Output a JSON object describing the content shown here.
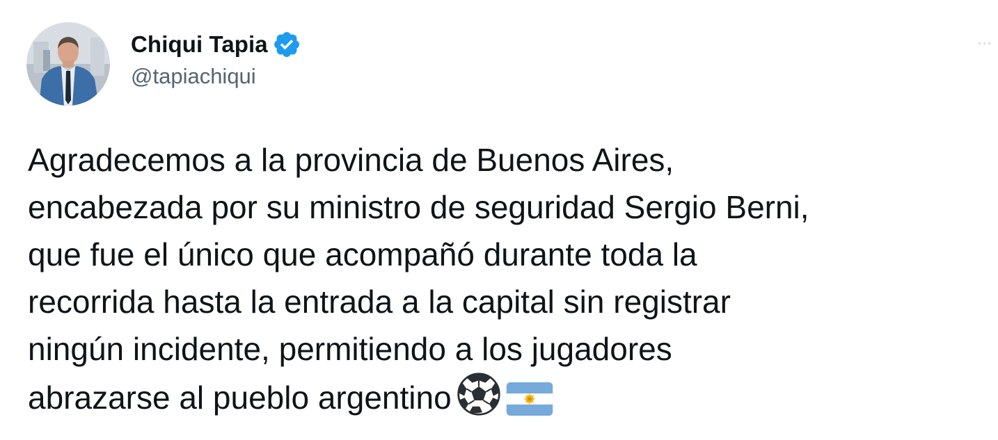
{
  "user": {
    "display_name": "Chiqui Tapia",
    "handle": "@tapiachiqui",
    "verified_icon": "verified-badge-icon"
  },
  "tweet": {
    "lines": [
      "Agradecemos a la provincia de Buenos Aires,",
      "encabezada por su ministro de seguridad Sergio Berni,",
      "que fue el único que acompañó durante toda la",
      "recorrida hasta la entrada a la capital sin registrar",
      "ningún incidente, permitiendo a los jugadores",
      "abrazarse al pueblo argentino"
    ],
    "emojis": [
      "soccer-ball-icon",
      "argentina-flag-icon"
    ]
  },
  "colors": {
    "text": "#0f1419",
    "secondary_text": "#536471",
    "verified_blue": "#1d9bf0",
    "flag_blue": "#75aadb",
    "flag_sun": "#f6b40e"
  }
}
